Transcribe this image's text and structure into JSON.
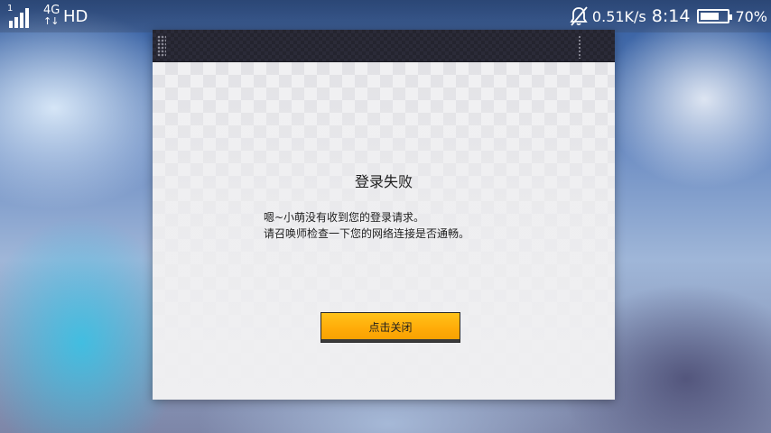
{
  "status_bar": {
    "sim_slot": "1",
    "network_type": "4G",
    "data_arrows": "↑↓",
    "hd_label": "HD",
    "speed": "0.51K/s",
    "time": "8:14",
    "battery_percent": "70%",
    "battery_level": 0.7,
    "icons": [
      "signal-icon",
      "mute-bell-icon",
      "battery-icon"
    ]
  },
  "dialog": {
    "title": "登录失败",
    "message_line1": "嗯~小萌没有收到您的登录请求。",
    "message_line2": "请召唤师检查一下您的网络连接是否通畅。",
    "close_button_label": "点击关闭"
  },
  "colors": {
    "button_accent": "#ffb30f",
    "header_dark": "#262631",
    "dialog_bg": "#eeeef0"
  }
}
